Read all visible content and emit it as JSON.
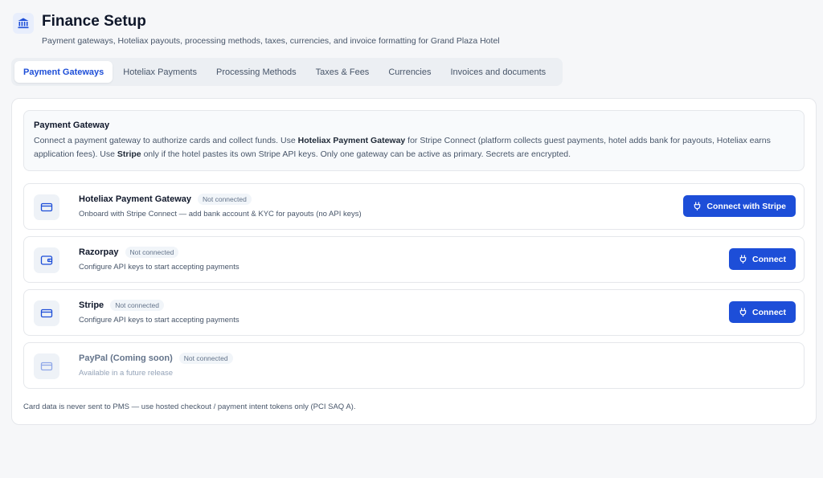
{
  "header": {
    "title": "Finance Setup",
    "subtitle": "Payment gateways, Hoteliax payouts, processing methods, taxes, currencies, and invoice formatting for Grand Plaza Hotel",
    "icon": "bank-icon"
  },
  "tabs": [
    {
      "label": "Payment Gateways",
      "active": true
    },
    {
      "label": "Hoteliax Payments",
      "active": false
    },
    {
      "label": "Processing Methods",
      "active": false
    },
    {
      "label": "Taxes & Fees",
      "active": false
    },
    {
      "label": "Currencies",
      "active": false
    },
    {
      "label": "Invoices and documents",
      "active": false
    }
  ],
  "info": {
    "title": "Payment Gateway",
    "body_parts": [
      "Connect a payment gateway to authorize cards and collect funds. Use ",
      "Hoteliax Payment Gateway",
      " for Stripe Connect (platform collects guest payments, hotel adds bank for payouts, Hoteliax earns application fees). Use ",
      "Stripe",
      " only if the hotel pastes its own Stripe API keys. Only one gateway can be active as primary. Secrets are encrypted."
    ]
  },
  "gateways": [
    {
      "name": "Hoteliax Payment Gateway",
      "status": "Not connected",
      "description": "Onboard with Stripe Connect — add bank account & KYC for payouts (no API keys)",
      "button": "Connect with Stripe",
      "icon": "credit-card-icon"
    },
    {
      "name": "Razorpay",
      "status": "Not connected",
      "description": "Configure API keys to start accepting payments",
      "button": "Connect",
      "icon": "wallet-icon"
    },
    {
      "name": "Stripe",
      "status": "Not connected",
      "description": "Configure API keys to start accepting payments",
      "button": "Connect",
      "icon": "credit-card-icon"
    },
    {
      "name": "PayPal (Coming soon)",
      "status": "Not connected",
      "description": "Available in a future release",
      "icon": "credit-card-icon"
    }
  ],
  "footnote": "Card data is never sent to PMS — use hosted checkout / payment intent tokens only (PCI SAQ A).",
  "colors": {
    "accent": "#1d4ed8",
    "background": "#f6f7f9"
  }
}
